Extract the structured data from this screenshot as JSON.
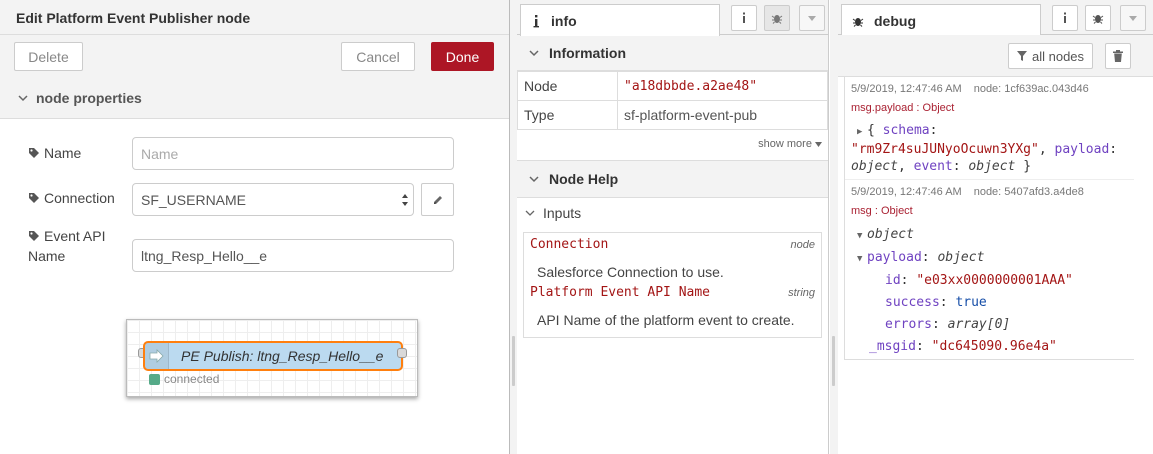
{
  "editor": {
    "title": "Edit Platform Event Publisher node",
    "delete_label": "Delete",
    "cancel_label": "Cancel",
    "done_label": "Done",
    "section_label": "node properties",
    "fields": {
      "name_label": "Name",
      "name_placeholder": "Name",
      "connection_label": "Connection",
      "connection_value": "SF_USERNAME",
      "event_api_label_line1": "Event API",
      "event_api_label_line2": "Name",
      "event_api_value": "ltng_Resp_Hello__e"
    },
    "preview": {
      "node_label": "PE Publish: ltng_Resp_Hello__e",
      "status_text": "connected"
    }
  },
  "info_panel": {
    "tab_label": "info",
    "tab_icon": "info-icon",
    "information_header": "Information",
    "rows": [
      {
        "key": "Node",
        "value": "\"a18dbbde.a2ae48\""
      },
      {
        "key": "Type",
        "value": "sf-platform-event-pub"
      }
    ],
    "show_more": "show more",
    "node_help_header": "Node Help",
    "inputs_label": "Inputs",
    "help_props": [
      {
        "name": "Connection",
        "type": "node",
        "desc": "Salesforce Connection to use."
      },
      {
        "name": "Platform Event API Name",
        "type": "string",
        "desc": "API Name of the platform event to create."
      }
    ]
  },
  "debug_panel": {
    "tab_label": "debug",
    "tab_icon": "bug-icon",
    "filter_label": "all nodes",
    "messages": [
      {
        "timestamp": "5/9/2019, 12:47:46 AM",
        "node": "node: 1cf639ac.043d46",
        "topic": "msg.payload : Object",
        "schema_key": "schema",
        "schema_value": "\"rm9Zr4suJUNyoOcuwn3YXg\"",
        "payload_key": "payload",
        "payload_type": "object",
        "event_key": "event",
        "event_type": "object"
      },
      {
        "timestamp": "5/9/2019, 12:47:46 AM",
        "node": "node: 5407afd3.a4de8",
        "topic": "msg : Object",
        "root_type": "object",
        "payload_key": "payload",
        "payload_type": "object",
        "id_key": "id",
        "id_value": "\"e03xx0000000001AAA\"",
        "success_key": "success",
        "success_value": "true",
        "errors_key": "errors",
        "errors_type": "array[0]",
        "msgid_key": "_msgid",
        "msgid_value": "\"dc645090.96e4a\""
      }
    ]
  },
  "colors": {
    "done_button": "#ad1625",
    "node_fill": "#bbdaf0",
    "node_selected_border": "#ff7f0e",
    "status_connected": "#55aa88",
    "string_value": "#a31515"
  }
}
